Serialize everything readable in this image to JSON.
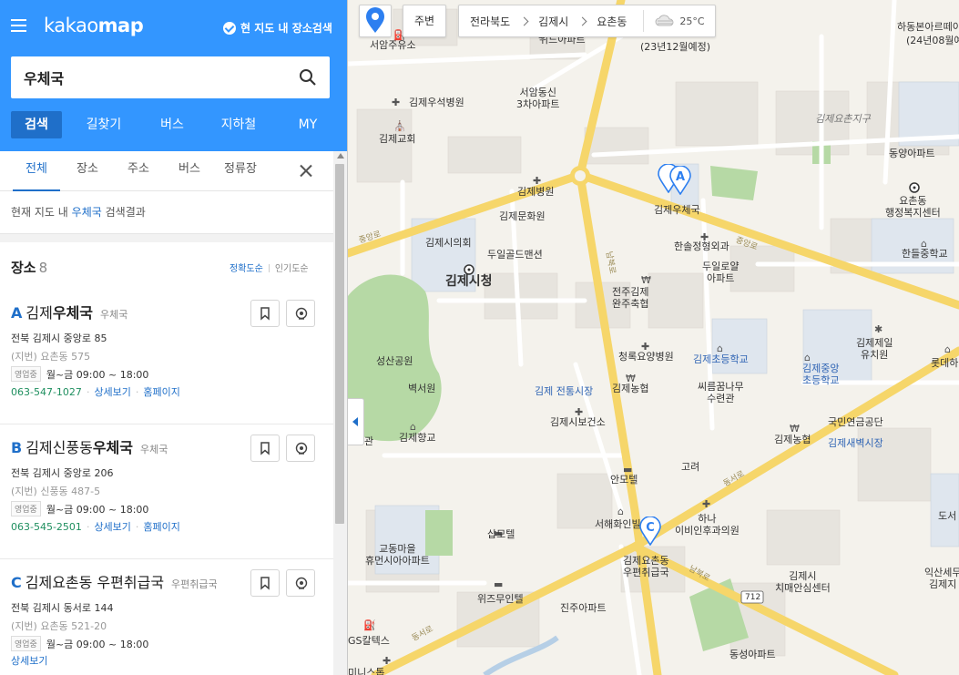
{
  "header": {
    "logo_light": "kakao",
    "logo_bold": "map",
    "area_search_label": "현 지도 내 장소검색"
  },
  "search": {
    "value": "우체국"
  },
  "nav_tabs": [
    {
      "label": "검색"
    },
    {
      "label": "길찾기"
    },
    {
      "label": "버스"
    },
    {
      "label": "지하철"
    },
    {
      "label": "MY"
    }
  ],
  "sub_tabs": [
    {
      "label": "전체"
    },
    {
      "label": "장소"
    },
    {
      "label": "주소"
    },
    {
      "label": "버스"
    },
    {
      "label": "정류장"
    }
  ],
  "result_info": {
    "prefix": "현재 지도 내",
    "keyword": "우체국",
    "suffix": "검색결과"
  },
  "places_section": {
    "title": "장소",
    "count": "8",
    "sort_accuracy": "정확도순",
    "sort_popularity": "인기도순"
  },
  "places": [
    {
      "letter": "A",
      "name_pre": "김제",
      "name_hl": "우체국",
      "name_post": "",
      "category": "우체국",
      "address": "전북 김제시 중앙로 85",
      "jibun": "(지번) 요촌동 575",
      "status": "영업중",
      "hours": "월~금 09:00 ~ 18:00",
      "phone": "063-547-1027",
      "detail": "상세보기",
      "homepage": "홈페이지"
    },
    {
      "letter": "B",
      "name_pre": "김제신풍동",
      "name_hl": "우체국",
      "name_post": "",
      "category": "우체국",
      "address": "전북 김제시 중앙로 206",
      "jibun": "(지번) 신풍동 487-5",
      "status": "영업중",
      "hours": "월~금 09:00 ~ 18:00",
      "phone": "063-545-2501",
      "detail": "상세보기",
      "homepage": "홈페이지"
    },
    {
      "letter": "C",
      "name_pre": "김제요촌동 우편취급국",
      "name_hl": "",
      "name_post": "",
      "category": "우편취급국",
      "address": "전북 김제시 동서로 144",
      "jibun": "(지번) 요촌동 521-20",
      "status": "영업중",
      "hours": "월~금 09:00 ~ 18:00",
      "phone": "",
      "detail": "상세보기",
      "homepage": ""
    }
  ],
  "map": {
    "nearby": "주변",
    "breadcrumb": [
      "전라북도",
      "김제시",
      "요촌동"
    ],
    "weather": "25°C",
    "labels": {
      "seoam": "서암주유소",
      "widuapt": "위드아파트",
      "planned": "(23년12월예정)",
      "hadong": "하동본아르떼이",
      "planned2": "(24년08월예",
      "wooseok": "김제우석병원",
      "seoam3": "서암동신\n3차아파트",
      "church": "김제교회",
      "yochonjigu": "김제요촌지구",
      "dongyang": "동양아파트",
      "gimje_hosp": "김제병원",
      "gimje_post": "김제우체국",
      "yochon_office": "요촌동\n행정복지센터",
      "munhwa": "김제문화원",
      "cityhall_park": "김제시의회",
      "duil": "두일골드맨션",
      "hansol": "한솔정형외과",
      "handeul": "한들중학교",
      "jungang_road": "중앙로",
      "nambuk": "남북로",
      "cityhall": "김제시청",
      "duilro": "두일로얄\n아파트",
      "jeonju": "전주김제\n완주축협",
      "seongsan": "성산공원",
      "cheongrok": "청록요양병원",
      "chodeung": "김제초등학교",
      "jungang_school": "김제중앙\n초등학교",
      "jeil": "김제제일\n유치원",
      "lotte": "롯데하이",
      "byeokseong": "벽서원",
      "market": "김제 전통시장",
      "nonghyup": "김제농협",
      "ssiri": "씨름꿈나무\n수련관",
      "health": "김제시보건소",
      "pension": "국민연금공단",
      "saebyeok": "김제새벽시장",
      "hyanggyo": "김제향교",
      "nonghyup2": "김제농협",
      "dongseoro": "동서로",
      "amotel": "안모텔",
      "goryeo": "고려",
      "gwan": "관",
      "seohae": "서해화인빌",
      "hana": "하나\n이비인후과의원",
      "gyodong": "교동마을\n휴먼시아아파트",
      "sap": "삽모텔",
      "yochon_postal": "김제요촌동\n우편취급국",
      "chime": "김제시\n치매안심센터",
      "iksan": "익산세무\n김제지",
      "wiz": "위즈무인텔",
      "jinju": "진주아파트",
      "gs": "GS칼텍스",
      "dongseong": "동성아파트",
      "minisu": "미니스톱",
      "road712": "712",
      "nambuk2": "남북로",
      "dongseo2": "동서로",
      "dose": "도서"
    }
  },
  "colors": {
    "accent": "#3396ff",
    "dark_accent": "#1f6fc9",
    "marker": "#2d7ff0"
  }
}
